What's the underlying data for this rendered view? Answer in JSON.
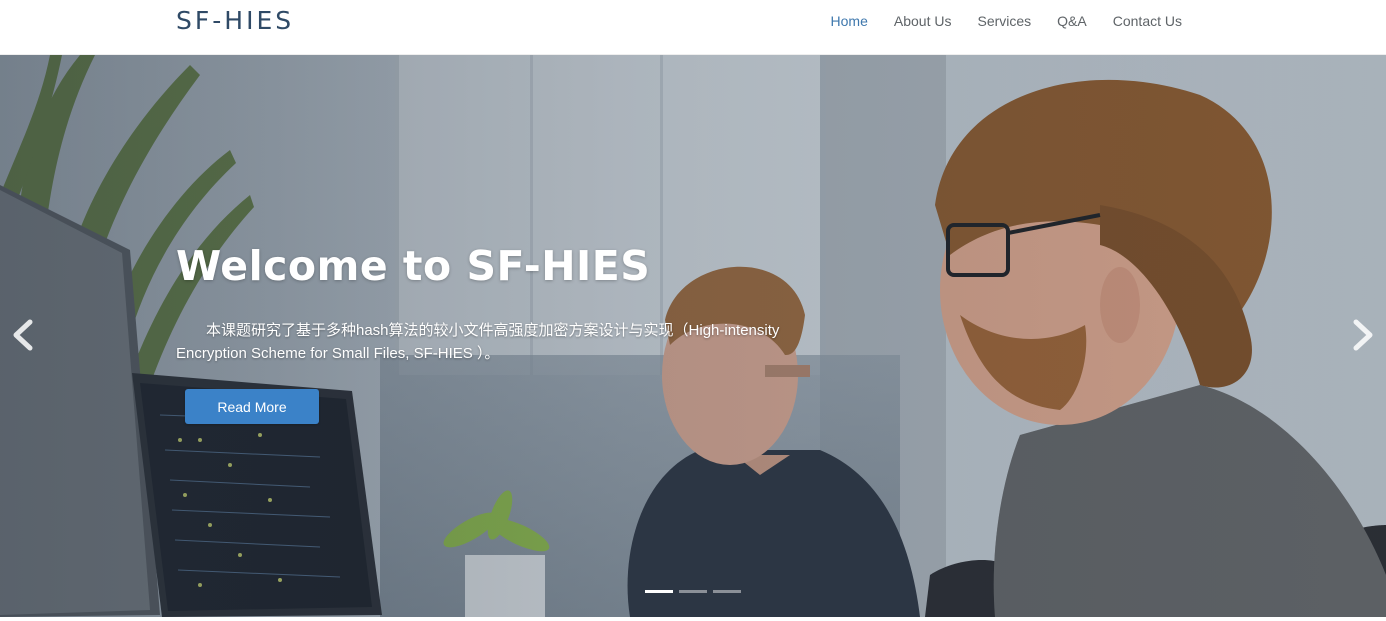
{
  "header": {
    "logo": "SF-HIES",
    "nav": [
      {
        "label": "Home",
        "active": true
      },
      {
        "label": "About Us",
        "active": false
      },
      {
        "label": "Services",
        "active": false
      },
      {
        "label": "Q&A",
        "active": false
      },
      {
        "label": "Contact Us",
        "active": false
      }
    ]
  },
  "hero": {
    "title": "Welcome to SF-HIES",
    "description": "本课题研究了基于多种hash算法的较小文件高强度加密方案设计与实现（High-intensity Encryption Scheme for Small Files, SF-HIES ）。",
    "button_label": "Read More",
    "slides_total": 3,
    "active_slide": 1
  },
  "colors": {
    "accent": "#3b82c8",
    "nav_active": "#3f78ad",
    "logo": "#2f4a66"
  },
  "icons": {
    "prev": "chevron-left-icon",
    "next": "chevron-right-icon"
  }
}
